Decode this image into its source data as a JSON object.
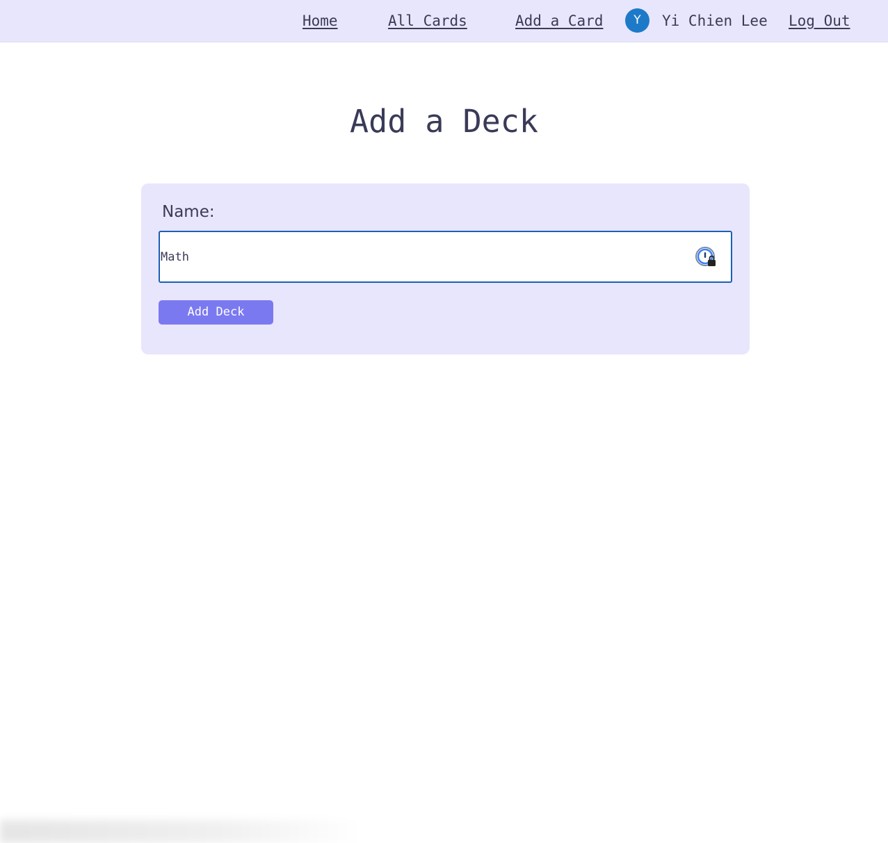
{
  "nav": {
    "home": "Home",
    "all_cards": "All Cards",
    "add_card": "Add a Card",
    "user_initial": "Y",
    "user_name": "Yi Chien Lee",
    "logout": "Log Out"
  },
  "page": {
    "title": "Add a Deck"
  },
  "form": {
    "name_label": "Name:",
    "name_value": "Math",
    "submit_label": "Add Deck",
    "password_manager_icon": "password-manager-lock-icon"
  },
  "colors": {
    "nav_background": "#e8e6fc",
    "card_background": "#e8e6fc",
    "button_background": "#7b79f0",
    "avatar_background": "#1d7ac8",
    "input_border": "#1b5fb3",
    "text": "#3a3a58"
  }
}
